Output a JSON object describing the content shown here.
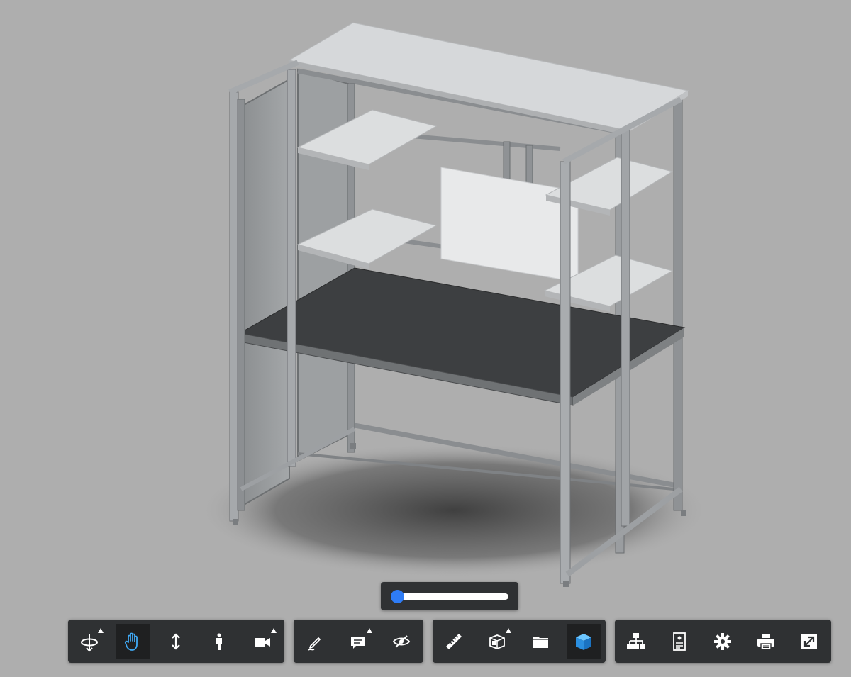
{
  "viewer": {
    "model": "workstation-frame",
    "background_color": "#aeaeae",
    "accent_color": "#2e7cf6",
    "toolbar_color": "#2f3133"
  },
  "explode_slider": {
    "value": 0
  },
  "toolbar": {
    "navigation": [
      {
        "icon": "orbit-icon",
        "flyout": true,
        "active": false
      },
      {
        "icon": "pan-hand-icon",
        "flyout": false,
        "active": true
      },
      {
        "icon": "zoom-icon",
        "flyout": false,
        "active": false
      },
      {
        "icon": "first-person-icon",
        "flyout": false,
        "active": false
      },
      {
        "icon": "camera-icon",
        "flyout": true,
        "active": false
      }
    ],
    "review": [
      {
        "icon": "markup-pencil-icon",
        "flyout": false,
        "active": false
      },
      {
        "icon": "comment-icon",
        "flyout": true,
        "active": false
      },
      {
        "icon": "hide-eye-icon",
        "flyout": false,
        "active": false
      }
    ],
    "analysis": [
      {
        "icon": "measure-ruler-icon",
        "flyout": false,
        "active": false
      },
      {
        "icon": "section-box-icon",
        "flyout": true,
        "active": false
      },
      {
        "icon": "folder-icon",
        "flyout": false,
        "active": false
      },
      {
        "icon": "model-cube-icon",
        "flyout": false,
        "active": true
      }
    ],
    "settings": [
      {
        "icon": "model-tree-icon",
        "flyout": false,
        "active": false
      },
      {
        "icon": "properties-icon",
        "flyout": false,
        "active": false
      },
      {
        "icon": "gear-icon",
        "flyout": false,
        "active": false
      },
      {
        "icon": "printer-icon",
        "flyout": false,
        "active": false
      },
      {
        "icon": "fullscreen-icon",
        "flyout": false,
        "active": false
      }
    ]
  }
}
